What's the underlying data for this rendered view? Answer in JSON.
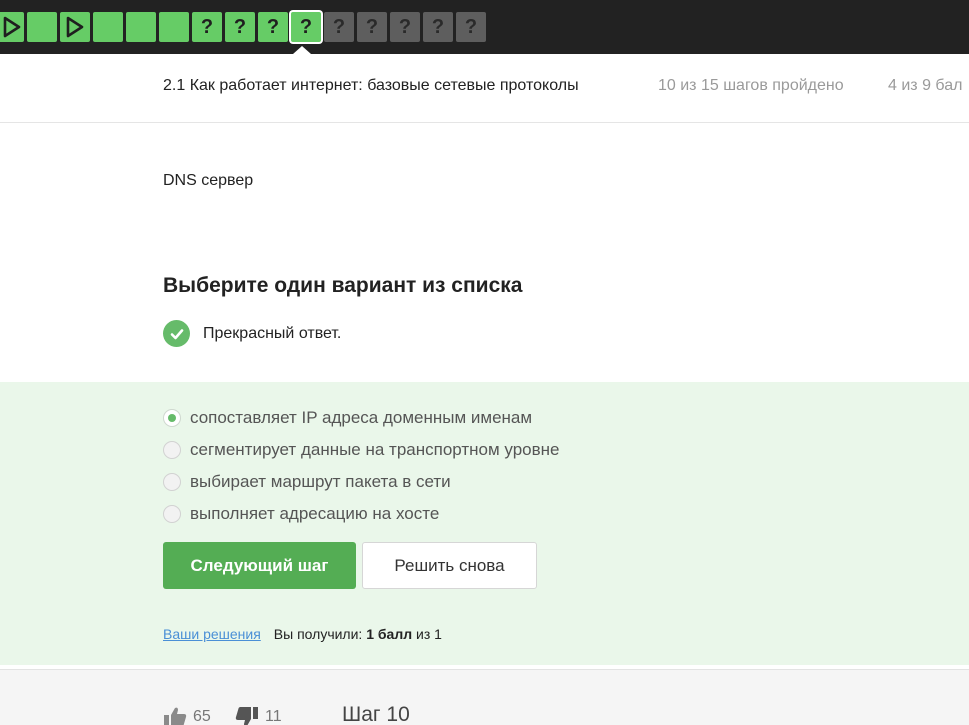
{
  "step_bar": {
    "steps": [
      {
        "kind": "video",
        "state": "green"
      },
      {
        "kind": "text",
        "state": "green"
      },
      {
        "kind": "video",
        "state": "green"
      },
      {
        "kind": "text",
        "state": "green"
      },
      {
        "kind": "text",
        "state": "green"
      },
      {
        "kind": "text",
        "state": "green"
      },
      {
        "kind": "quiz",
        "state": "green",
        "symbol": "?"
      },
      {
        "kind": "quiz",
        "state": "green",
        "symbol": "?"
      },
      {
        "kind": "quiz",
        "state": "green",
        "symbol": "?"
      },
      {
        "kind": "quiz",
        "state": "green",
        "symbol": "?",
        "current": true
      },
      {
        "kind": "quiz",
        "state": "grey",
        "symbol": "?"
      },
      {
        "kind": "quiz",
        "state": "grey",
        "symbol": "?"
      },
      {
        "kind": "quiz",
        "state": "grey",
        "symbol": "?"
      },
      {
        "kind": "quiz",
        "state": "grey",
        "symbol": "?"
      },
      {
        "kind": "quiz",
        "state": "grey",
        "symbol": "?"
      }
    ]
  },
  "lesson": {
    "title": "2.1 Как работает интернет: базовые сетевые протоколы",
    "progress": "10 из 15 шагов пройдено",
    "score": "4 из 9 бал"
  },
  "question": {
    "text": "DNS сервер",
    "heading": "Выберите один вариант из списка",
    "feedback": "Прекрасный ответ."
  },
  "options": [
    {
      "label": "сопоставляет IP адреса доменным именам",
      "checked": true
    },
    {
      "label": "сегментирует данные на транспортном уровне",
      "checked": false
    },
    {
      "label": "выбирает маршрут пакета в сети",
      "checked": false
    },
    {
      "label": "выполняет адресацию на хосте",
      "checked": false
    }
  ],
  "buttons": {
    "next": "Следующий шаг",
    "retry": "Решить снова"
  },
  "result": {
    "link": "Ваши решения",
    "prefix": "Вы получили:",
    "points": "1 балл",
    "suffix": "из 1"
  },
  "footer": {
    "likes": "65",
    "dislikes": "11",
    "step_label": "Шаг 10"
  },
  "colors": {
    "accent_green": "#54ad54",
    "step_green": "#66cc66",
    "step_grey": "#5e5e5e",
    "answer_bg": "#eaf7ea",
    "link_blue": "#4a8fd6"
  }
}
